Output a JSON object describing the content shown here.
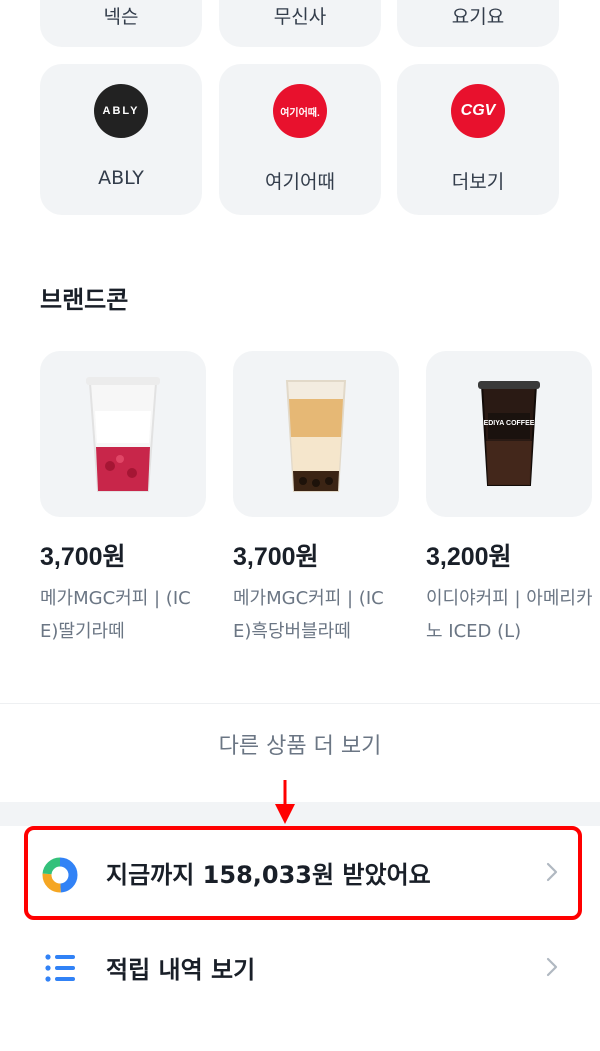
{
  "top_tiles": [
    "넥슨",
    "무신사",
    "요기요"
  ],
  "brand_tiles": [
    {
      "label": "ABLY",
      "logo_text": "ABLY",
      "logo_bg": "#222222"
    },
    {
      "label": "여기어때",
      "logo_text": "여기어때.",
      "logo_bg": "#e8112d"
    },
    {
      "label": "더보기",
      "logo_text": "CGV",
      "logo_bg": "#e8112d"
    }
  ],
  "brandcon": {
    "title": "브랜드콘",
    "items": [
      {
        "price": "3,700원",
        "name": "메가MGC커피 | (ICE)딸기라떼"
      },
      {
        "price": "3,700원",
        "name": "메가MGC커피 | (ICE)흑당버블라떼"
      },
      {
        "price": "3,200원",
        "name": "이디야커피 | 아메리카노 ICED (L)"
      }
    ],
    "cup3_label": "EDIYA COFFEE"
  },
  "more_button": "다른 상품 더 보기",
  "rows": {
    "received": "지금까지 158,033원 받았어요",
    "history": "적립 내역 보기"
  },
  "colors": {
    "highlight": "#ff0000",
    "accent_blue": "#3182f6"
  }
}
